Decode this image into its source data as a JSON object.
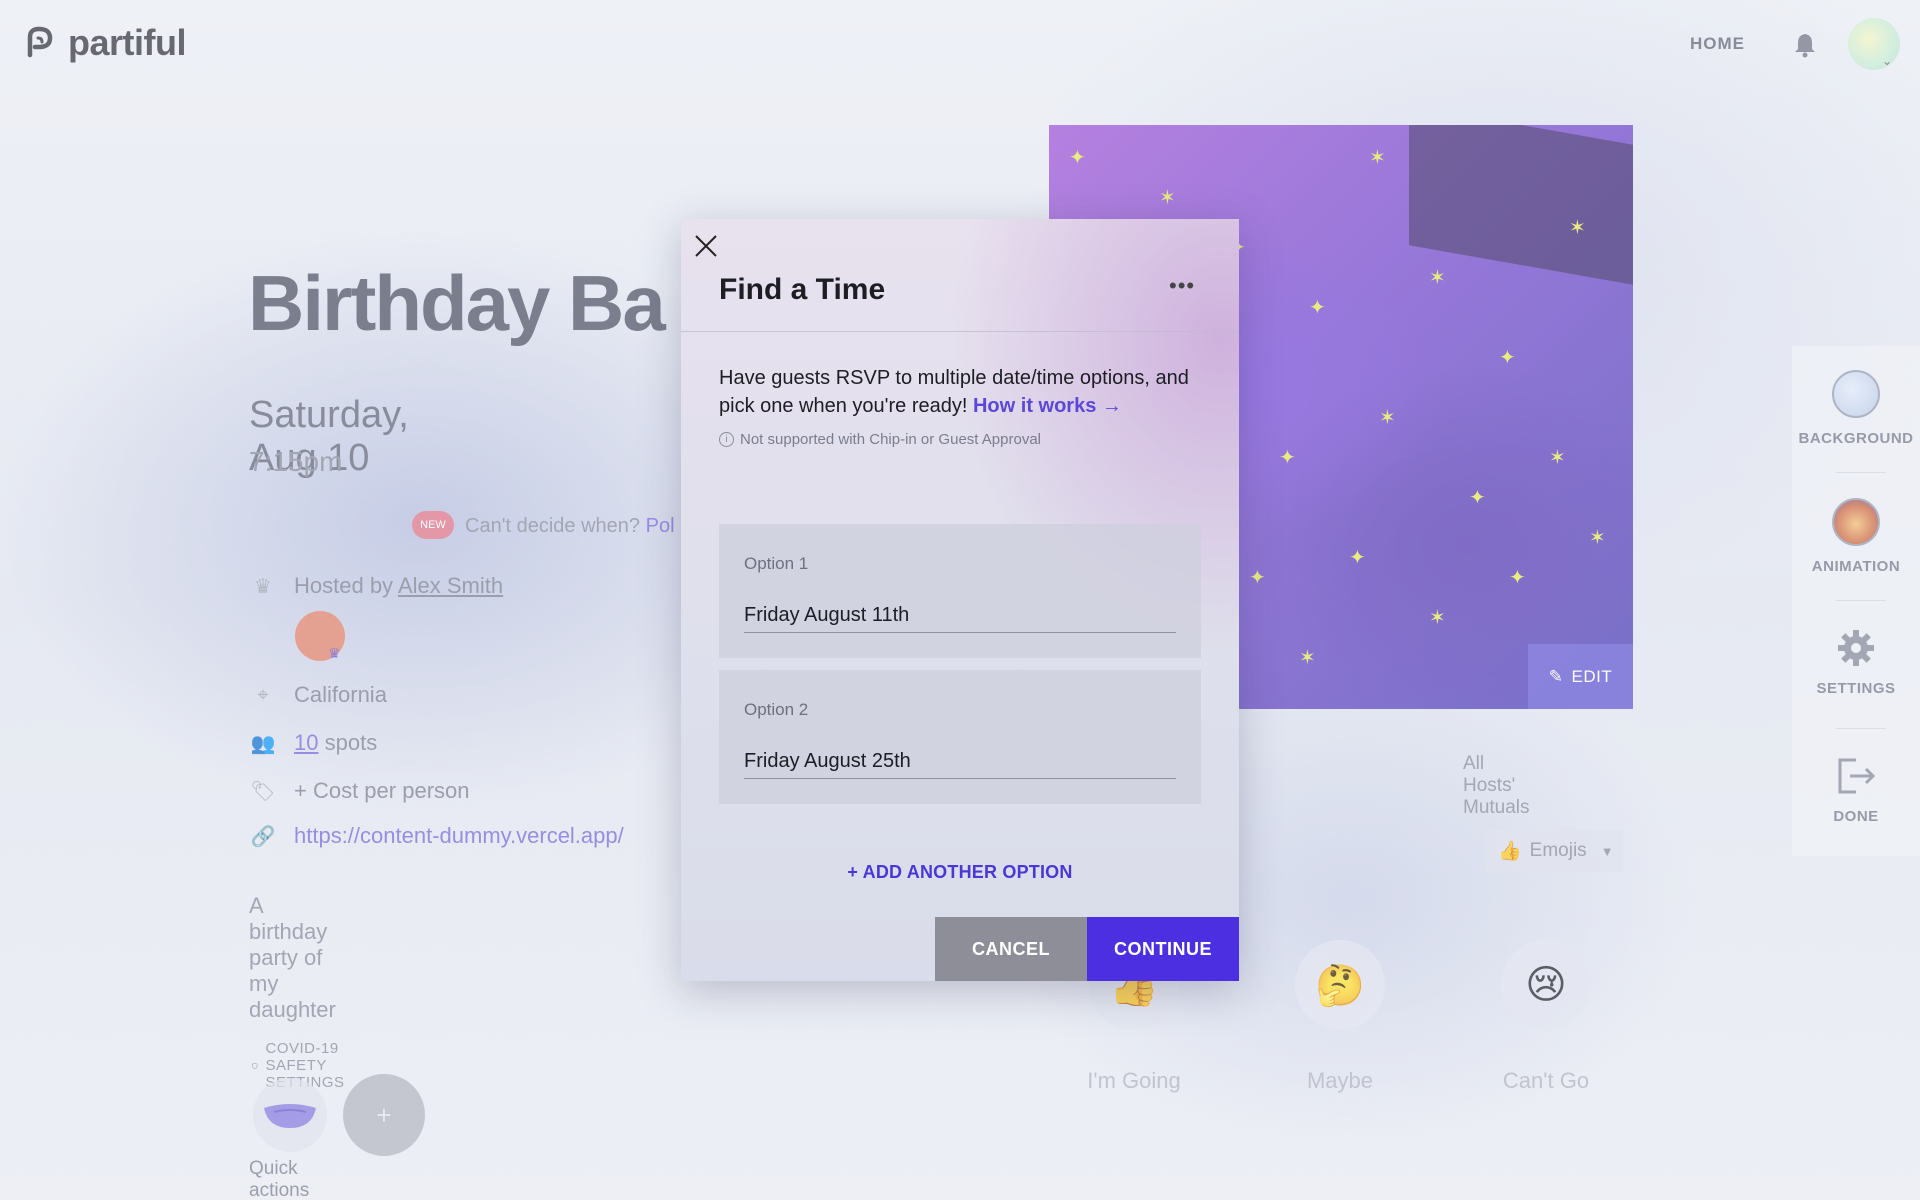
{
  "app": {
    "logo_text": "partiful"
  },
  "header": {
    "home_label": "HOME"
  },
  "event": {
    "title": "Birthday Ba",
    "date": "Saturday, Aug 10",
    "time": "7:15pm",
    "new_badge": "NEW",
    "cant_decide": "Can't decide when?",
    "poll_link": "Pol",
    "hosted_by_prefix": "Hosted by",
    "host_name": "Alex Smith",
    "location": "California",
    "spots_count": "10",
    "spots_suffix": "spots",
    "cost": "+ Cost per person",
    "link": "https://content-dummy.vercel.app/",
    "description": "A birthday party of my daughter",
    "covid_label": "COVID-19 SAFETY SETTINGS",
    "plus_label": "+",
    "quick_actions": "Quick actions for hosts",
    "edit_label": "EDIT",
    "mutuals": "All Hosts' Mutuals",
    "emoji_select": "Emojis",
    "rsvp": {
      "going": "I'm Going",
      "maybe": "Maybe",
      "cant_go": "Can't Go"
    }
  },
  "sidebar": {
    "background": "BACKGROUND",
    "animation": "ANIMATION",
    "settings": "SETTINGS",
    "done": "DONE"
  },
  "modal": {
    "title": "Find a Time",
    "more": "•••",
    "description": "Have guests RSVP to multiple date/time options, and pick one when you're ready!",
    "how_link": "How it works →",
    "note": "Not supported with Chip-in or Guest Approval",
    "options": [
      {
        "label": "Option 1",
        "value": "Friday August 11th"
      },
      {
        "label": "Option 2",
        "value": "Friday August 25th"
      }
    ],
    "add_option": "+ ADD ANOTHER OPTION",
    "cancel": "CANCEL",
    "continue": "CONTINUE"
  },
  "colors": {
    "accent": "#4b2fe0",
    "link": "#5b48d8",
    "cancel_bg": "#8d8e97",
    "new_badge": "#e07a8c"
  },
  "icons": [
    "partiful-logo-icon",
    "bell-icon",
    "close-icon",
    "more-icon",
    "crown-icon",
    "location-icon",
    "people-icon",
    "tag-icon",
    "link-icon",
    "shield-icon",
    "mask-icon",
    "edit-icon",
    "gear-icon",
    "exit-icon",
    "info-icon"
  ]
}
